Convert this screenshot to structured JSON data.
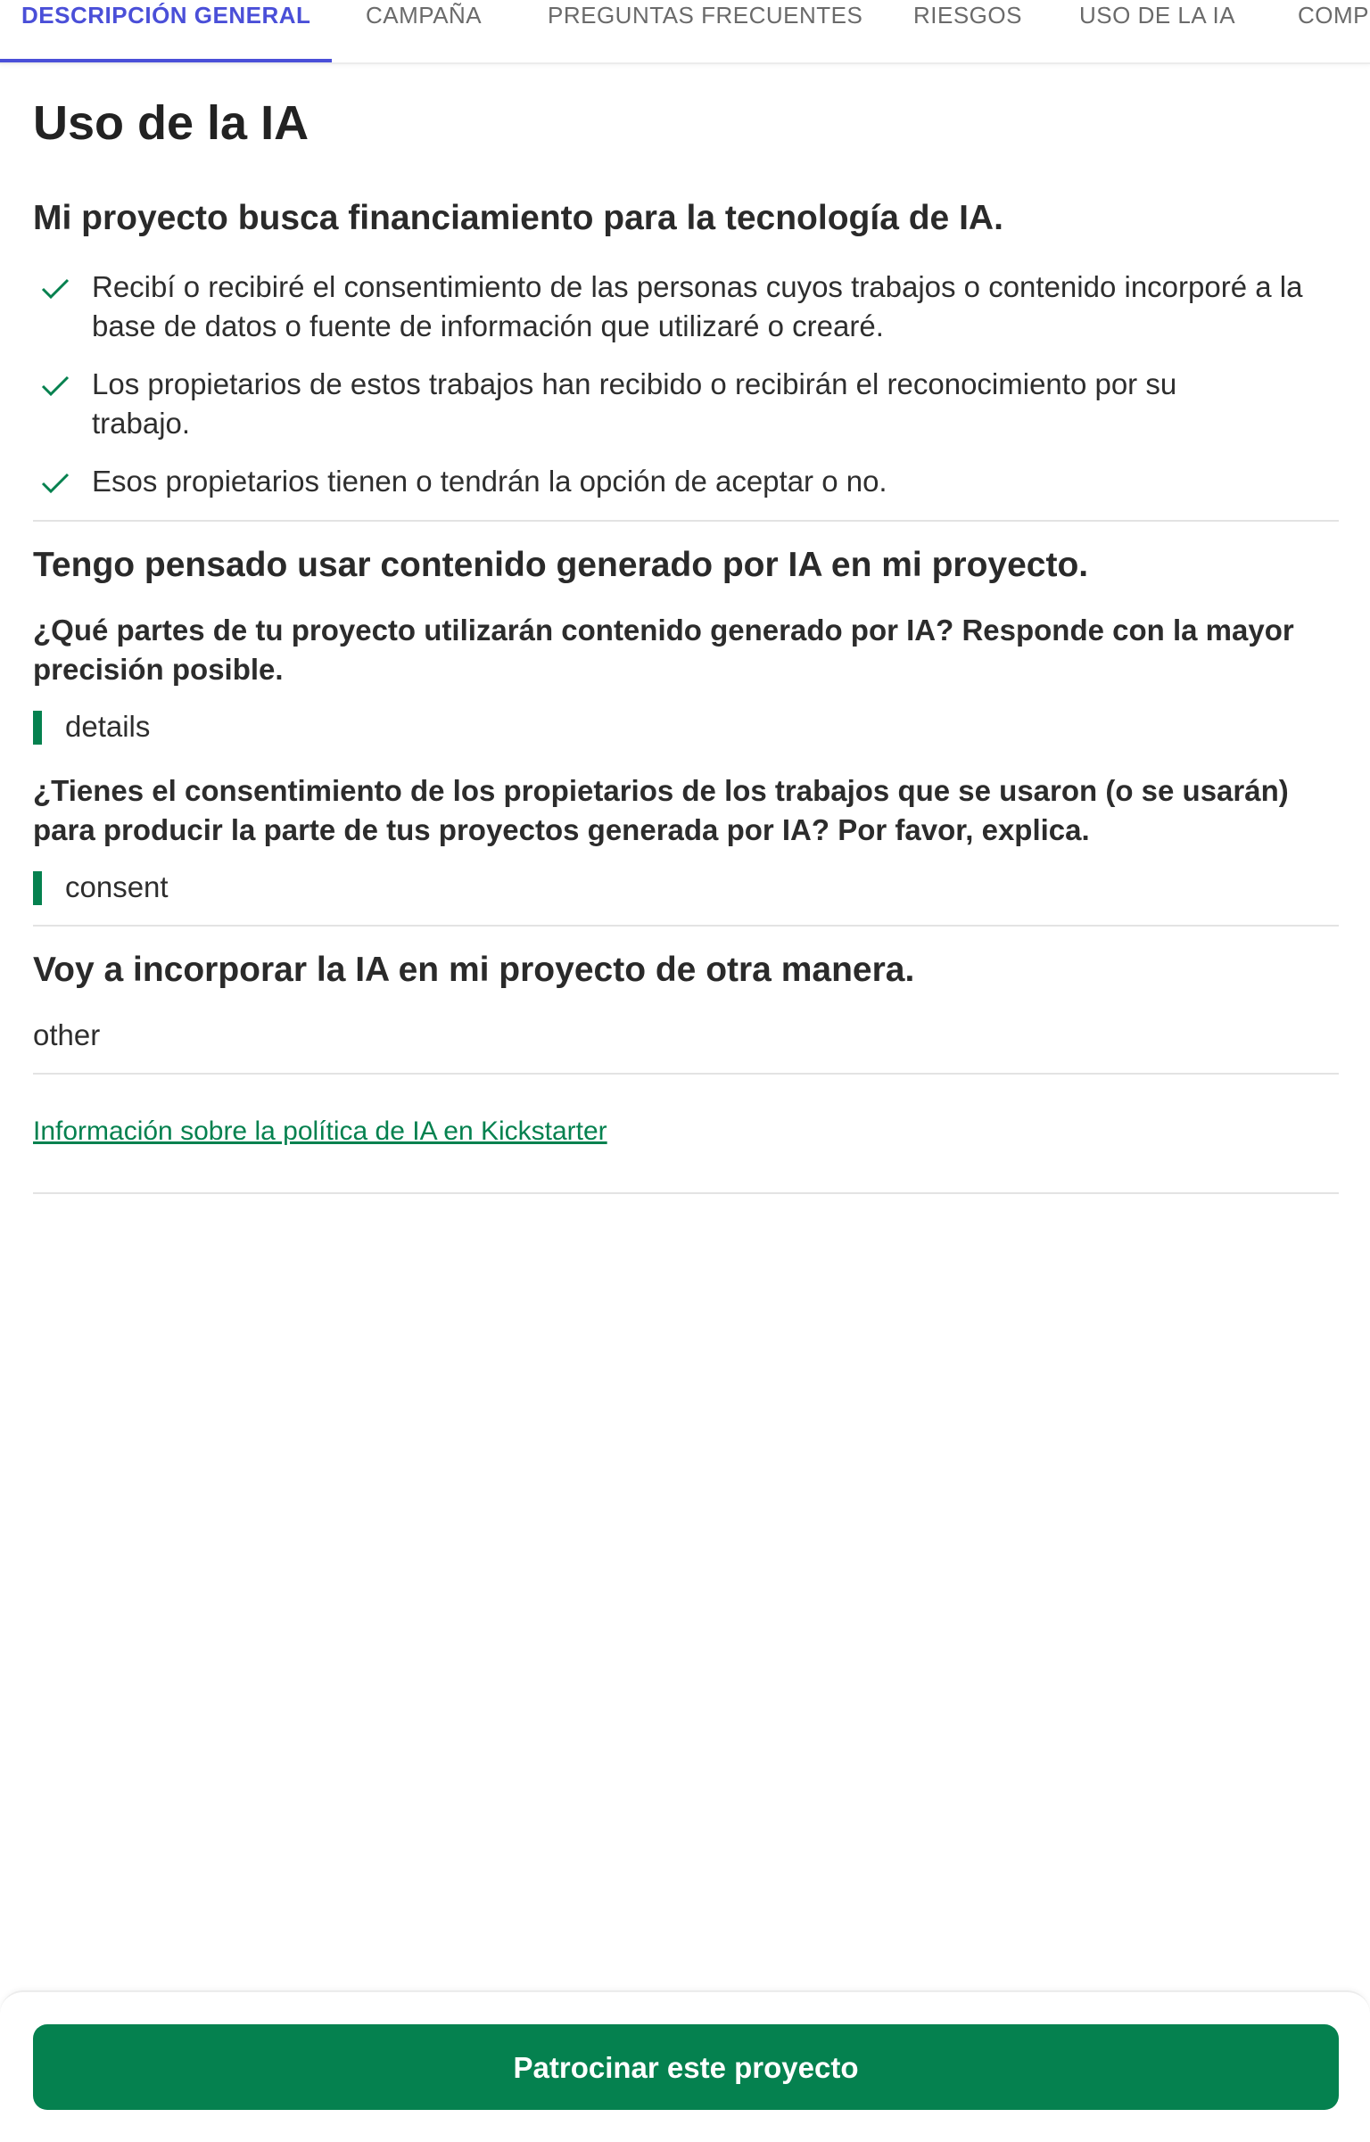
{
  "tabs": [
    {
      "label": "DESCRIPCIÓN GENERAL",
      "active": true
    },
    {
      "label": "CAMPAÑA",
      "active": false
    },
    {
      "label": "PREGUNTAS FRECUENTES",
      "active": false
    },
    {
      "label": "RIESGOS",
      "active": false
    },
    {
      "label": "USO DE LA IA",
      "active": false
    },
    {
      "label": "COMPI",
      "active": false
    }
  ],
  "page": {
    "title": "Uso de la IA"
  },
  "funding_section": {
    "title": "Mi proyecto busca financiamiento para la tecnología de IA.",
    "checks": [
      "Recibí o recibiré el consentimiento de las personas cuyos trabajos o contenido incorporé a la base de datos o fuente de información que utilizaré o crearé.",
      "Los propietarios de estos trabajos han recibido o recibirán el reconocimiento por su trabajo.",
      "Esos propietarios tienen o tendrán la opción de aceptar o no."
    ]
  },
  "generated_section": {
    "title": "Tengo pensado usar contenido generado por IA en mi proyecto.",
    "q1": "¿Qué partes de tu proyecto utilizarán contenido generado por IA? Responde con la mayor precisión posible.",
    "a1": "details",
    "q2": "¿Tienes el consentimiento de los propietarios de los trabajos que se usaron (o se usarán) para producir la parte de tus proyectos generada por IA? Por favor, explica.",
    "a2": "consent"
  },
  "other_section": {
    "title": "Voy a incorporar la IA en mi proyecto de otra manera.",
    "answer": "other"
  },
  "policy_link": "Información sobre la política de IA en Kickstarter",
  "action": {
    "button_label": "Patrocinar este proyecto"
  },
  "colors": {
    "tab_active": "#4a4fd8",
    "brand_green": "#05814f"
  },
  "icons": {
    "check": "check-icon"
  }
}
